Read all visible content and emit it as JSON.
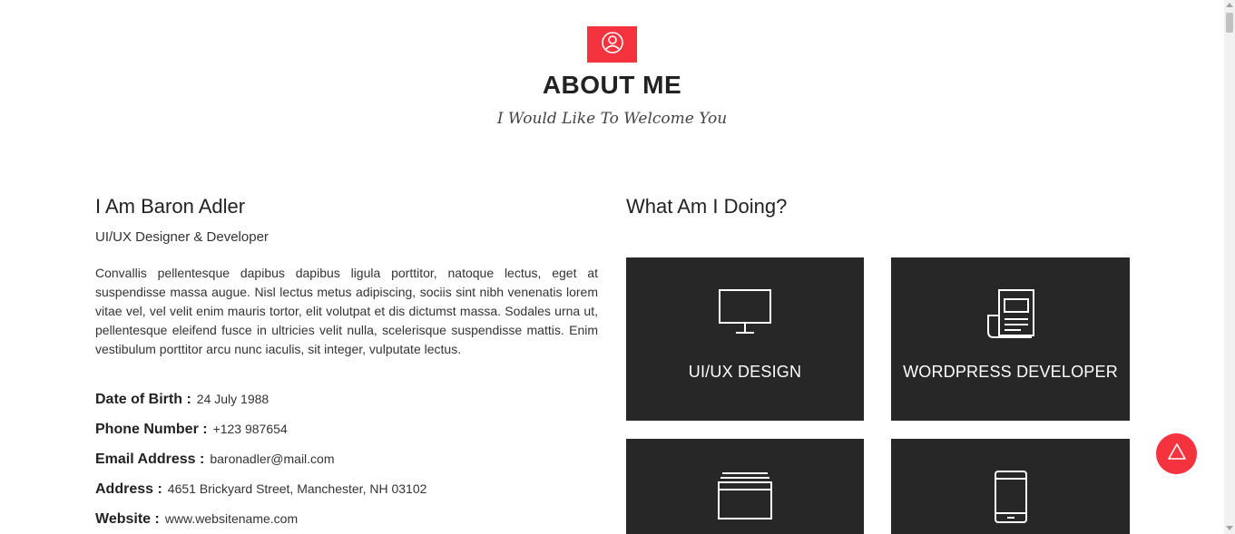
{
  "header": {
    "icon": "user-circle-icon",
    "title": "ABOUT ME",
    "subtitle": "I Would Like To Welcome You"
  },
  "intro": {
    "name": "I Am Baron Adler",
    "role": "UI/UX Designer & Developer",
    "bio": "Convallis pellentesque dapibus dapibus ligula porttitor, natoque lectus, eget at suspendisse massa augue. Nisl lectus metus adipiscing, sociis sint nibh venenatis lorem vitae vel, vel velit enim mauris tortor, elit volutpat et dis dictumst massa. Sodales urna ut, pellentesque eleifend fusce in ultricies velit nulla, scelerisque suspendisse mattis. Enim vestibulum porttitor arcu nunc iaculis, sit integer, vulputate lectus."
  },
  "info": [
    {
      "label": "Date of Birth :",
      "value": "24 July 1988"
    },
    {
      "label": "Phone Number :",
      "value": "+123 987654"
    },
    {
      "label": "Email Address :",
      "value": "baronadler@mail.com"
    },
    {
      "label": "Address :",
      "value": "4651 Brickyard Street, Manchester, NH 03102"
    },
    {
      "label": "Website :",
      "value": "www.websitename.com"
    }
  ],
  "doing": {
    "title": "What Am I Doing?",
    "services": [
      {
        "label": "UI/UX DESIGN",
        "icon": "monitor-icon"
      },
      {
        "label": "WORDPRESS DEVELOPER",
        "icon": "newspaper-icon"
      },
      {
        "label": "",
        "icon": "browser-window-icon"
      },
      {
        "label": "",
        "icon": "mobile-phone-icon"
      }
    ]
  },
  "back_to_top": {
    "icon": "triangle-up-icon"
  },
  "colors": {
    "accent": "#f5333f",
    "card_bg": "#272727",
    "text": "#222222"
  }
}
